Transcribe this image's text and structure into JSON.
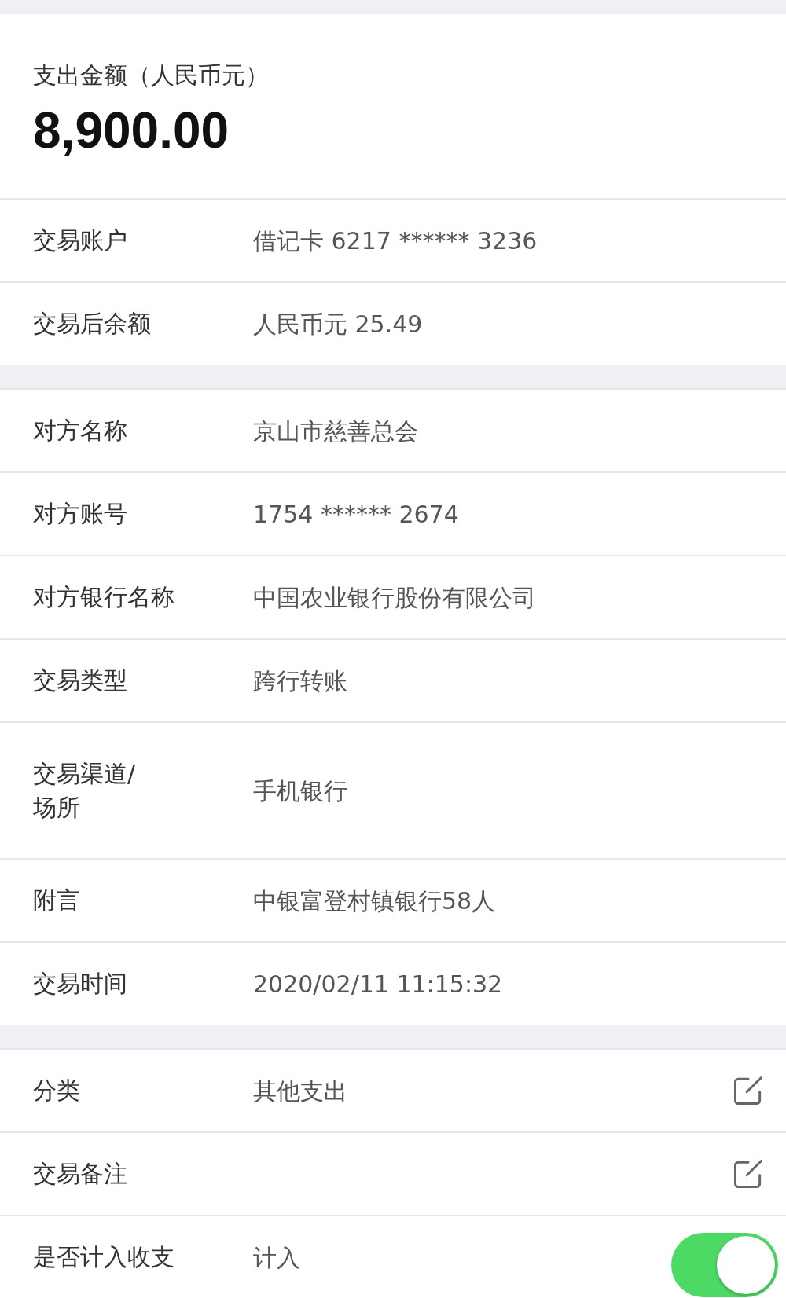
{
  "header": {
    "label": "支出金额（人民币元）",
    "amount": "8,900.00"
  },
  "sections": [
    {
      "rows": [
        {
          "kind": "text",
          "label": "交易账户",
          "value": "借记卡 6217 ****** 3236"
        },
        {
          "kind": "text",
          "label": "交易后余额",
          "value": "人民币元 25.49"
        }
      ]
    },
    {
      "rows": [
        {
          "kind": "text",
          "label": "对方名称",
          "value": "京山市慈善总会"
        },
        {
          "kind": "text",
          "label": "对方账号",
          "value": "1754 ****** 2674"
        },
        {
          "kind": "text",
          "label": "对方银行名称",
          "value": "中国农业银行股份有限公司"
        },
        {
          "kind": "text",
          "label": "交易类型",
          "value": "跨行转账"
        },
        {
          "kind": "text",
          "label": "交易渠道/\n场所",
          "value": "手机银行"
        },
        {
          "kind": "text",
          "label": "附言",
          "value": "中银富登村镇银行58人"
        },
        {
          "kind": "text",
          "label": "交易时间",
          "value": "2020/02/11  11:15:32"
        }
      ]
    },
    {
      "rows": [
        {
          "kind": "edit",
          "label": "分类",
          "value": "其他支出"
        },
        {
          "kind": "edit",
          "label": "交易备注"
        },
        {
          "kind": "toggle",
          "label": "是否计入收支",
          "value": "计入",
          "on": true
        }
      ]
    }
  ]
}
